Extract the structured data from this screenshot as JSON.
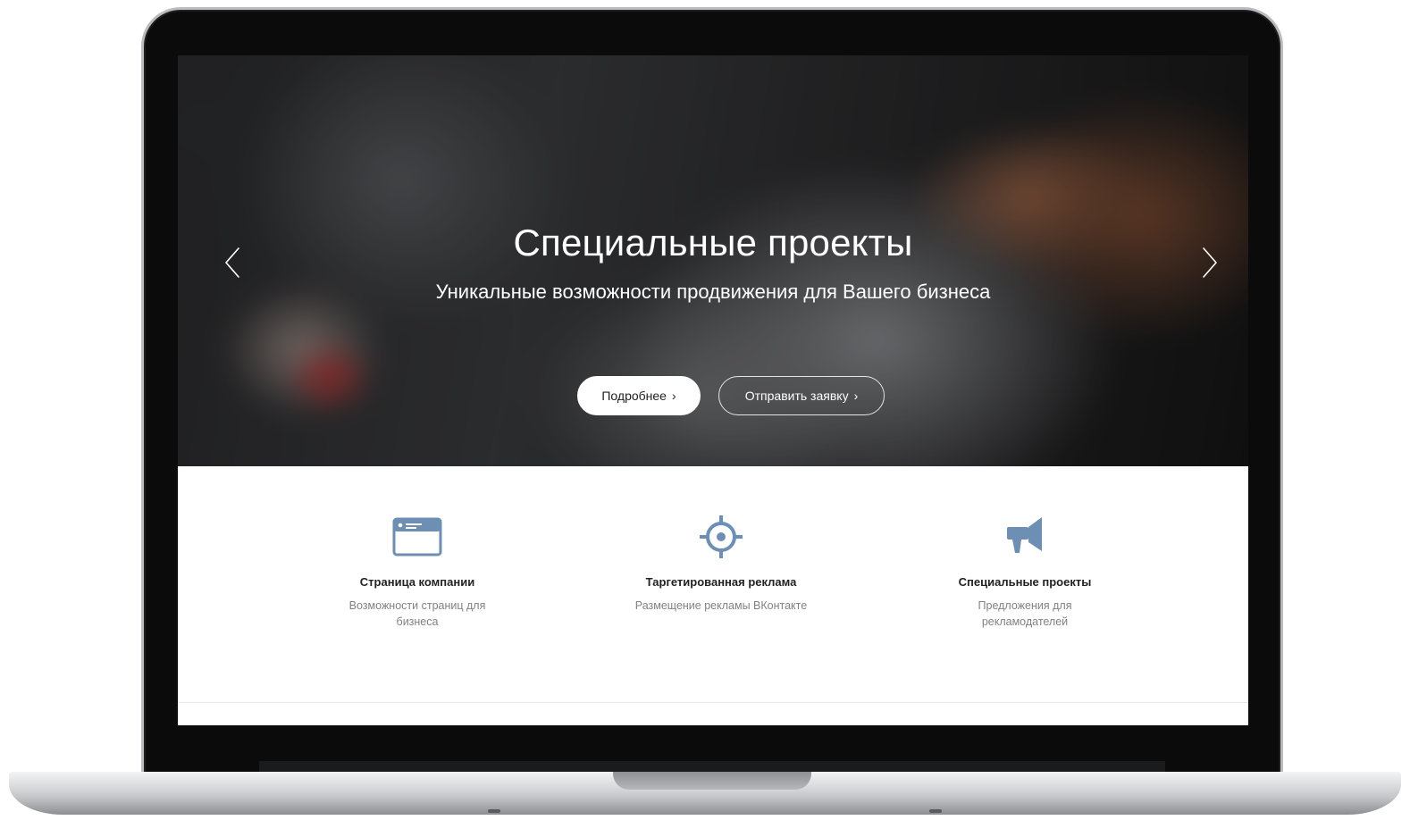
{
  "hero": {
    "title": "Специальные проекты",
    "subtitle": "Уникальные возможности продвижения для Вашего бизнеса",
    "primary_button": "Подробнее",
    "secondary_button": "Отправить заявку",
    "chevron": "›",
    "prev_icon": "chevron-left-icon",
    "next_icon": "chevron-right-icon"
  },
  "features": [
    {
      "icon": "browser-window-icon",
      "title": "Страница компании",
      "description": "Возможности страниц для бизнеса"
    },
    {
      "icon": "target-crosshair-icon",
      "title": "Таргетированная реклама",
      "description": "Размещение рекламы ВКонтакте"
    },
    {
      "icon": "megaphone-icon",
      "title": "Специальные проекты",
      "description": "Предложения для рекламодателей"
    }
  ],
  "colors": {
    "icon_accent": "#6d8fb3",
    "title_text": "#222222",
    "description_text": "#828282"
  }
}
